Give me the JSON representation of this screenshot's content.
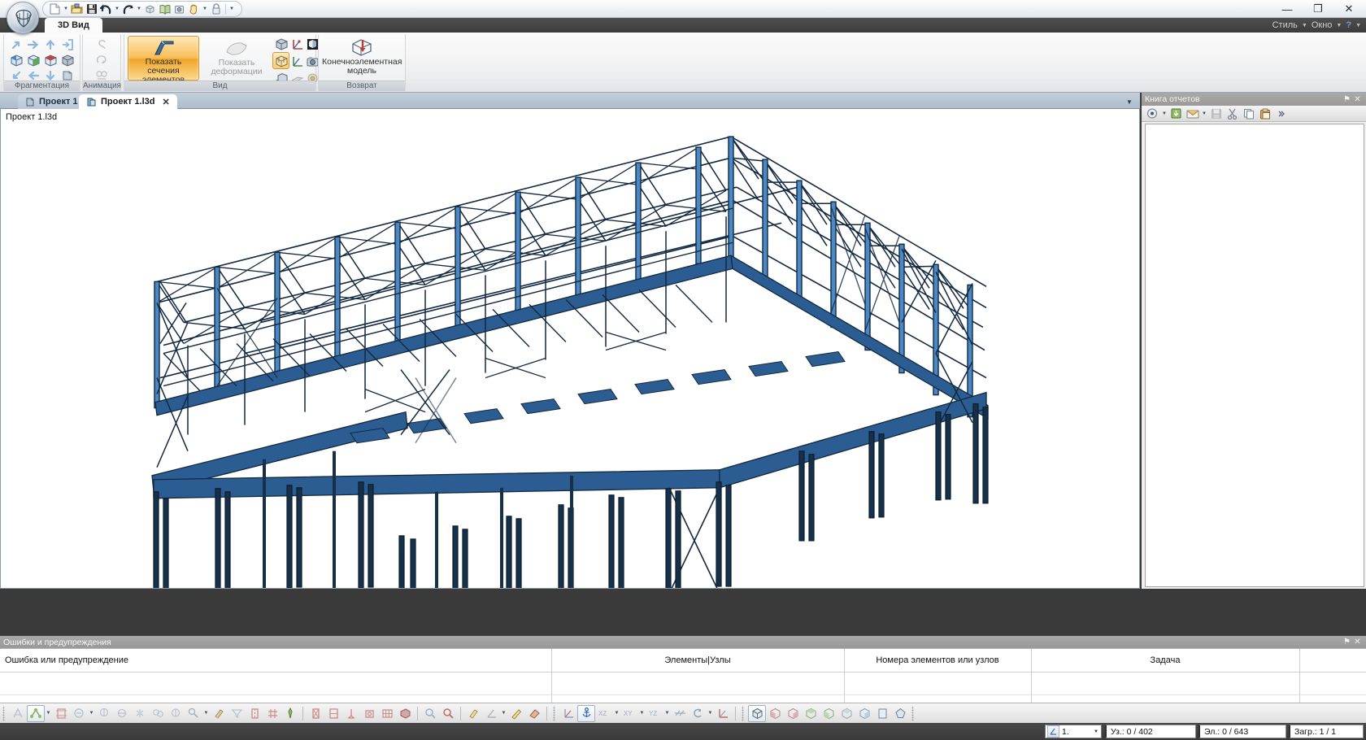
{
  "window": {
    "minimize_label": "—",
    "restore_label": "❐",
    "close_label": "✕"
  },
  "quick_access": {
    "items": [
      {
        "name": "new-document-icon",
        "glyph": "new"
      },
      {
        "name": "open-folder-icon",
        "glyph": "open"
      },
      {
        "name": "save-icon",
        "glyph": "save"
      },
      {
        "name": "undo-icon",
        "glyph": "undo"
      },
      {
        "name": "redo-icon",
        "glyph": "redo"
      },
      {
        "name": "model-icon",
        "glyph": "cube"
      },
      {
        "name": "book-icon",
        "glyph": "book"
      },
      {
        "name": "package-icon",
        "glyph": "package"
      },
      {
        "name": "hand-icon",
        "glyph": "hand"
      },
      {
        "name": "lock-icon",
        "glyph": "lock"
      },
      {
        "name": "customize-qat-icon",
        "glyph": "dropdown"
      }
    ]
  },
  "ribbon": {
    "tab": "3D Вид",
    "right_menu": {
      "style": "Стиль",
      "window": "Окно",
      "help": "?"
    },
    "groups": [
      {
        "id": "fragmentation",
        "label": "Фрагментация",
        "icons": [
          "arrow-up-right-icon",
          "arrow-right-icon",
          "arrow-up-icon",
          "arrow-into-box-icon",
          "cube-blue-icon",
          "cube-green-icon",
          "cube-red-icon",
          "cube-gray-icon",
          "arrow-down-left-icon",
          "arrow-left-icon",
          "arrow-down-icon",
          "box-restore-icon"
        ]
      },
      {
        "id": "animation",
        "label": "Анимация",
        "icons": [
          "loop-icon",
          "rotate-icon",
          "film-icon"
        ]
      },
      {
        "id": "view",
        "label": "Вид",
        "primary_button": "Показать сечения элементов",
        "primary_button_state": "active",
        "secondary_button": "Показать деформации",
        "secondary_button_state": "disabled",
        "icons": [
          "cube-solid-icon",
          "axes-red-icon",
          "cube-shaded-icon",
          "mesh-icon",
          "cube-grid-icon",
          "axes-green-icon",
          "camera-icon",
          "cube-origin-icon",
          "plane-icon",
          "sphere-icon"
        ]
      },
      {
        "id": "return",
        "label": "Возврат",
        "primary_button": "Конечноэлементная модель",
        "icons": [
          "fem-model-icon"
        ]
      }
    ]
  },
  "document_tabs": {
    "items": [
      {
        "label": "Проект 1",
        "active": false,
        "closable": false
      },
      {
        "label": "Проект 1.l3d",
        "active": true,
        "closable": true
      }
    ],
    "close_label": "✕",
    "overflow_label": "▼"
  },
  "viewport": {
    "label": "Проект 1.l3d",
    "background": "#ffffff",
    "model": {
      "name": "steel-frame-truss-structure",
      "edge_color": "#10263f",
      "column_color": "#4a88c8",
      "beam_color": "#2f6096",
      "fill_color": "#2b5d93"
    }
  },
  "report_panel": {
    "title": "Книга отчетов",
    "pin_label": "⚑",
    "close_label": "✕",
    "tools": [
      {
        "name": "report-new-icon"
      },
      {
        "name": "report-open-icon"
      },
      {
        "name": "report-mail-icon"
      },
      {
        "name": "report-save-icon"
      },
      {
        "name": "report-cut-icon"
      },
      {
        "name": "report-copy-icon"
      },
      {
        "name": "report-paste-icon"
      },
      {
        "name": "report-more-icon"
      }
    ]
  },
  "errors_panel": {
    "title": "Ошибки и предупреждения",
    "pin_label": "⚑",
    "close_label": "✕",
    "columns": [
      {
        "label": "Ошибка или предупреждение",
        "align": "left"
      },
      {
        "label": "Элементы|Узлы",
        "align": "center"
      },
      {
        "label": "Номера элементов или узлов",
        "align": "center"
      },
      {
        "label": "Задача",
        "align": "center"
      }
    ],
    "rows": []
  },
  "bottom_toolbar": {
    "groups": [
      {
        "name": "selection-tools",
        "items": [
          {
            "name": "select-all-icon",
            "selected": false
          },
          {
            "name": "select-nodes-icon",
            "selected": true,
            "dropdown": true
          },
          {
            "name": "select-frame-icon",
            "selected": false
          },
          {
            "name": "deselect-node-icon",
            "selected": false,
            "dropdown": true
          },
          {
            "name": "select-vertical-icon",
            "selected": false
          },
          {
            "name": "deselect-horizontal-icon",
            "selected": false
          },
          {
            "name": "select-star-icon",
            "selected": false
          },
          {
            "name": "select-group-icon",
            "selected": false
          },
          {
            "name": "select-single-icon",
            "selected": false
          },
          {
            "name": "pick-tool-icon",
            "selected": false,
            "dropdown": true
          },
          {
            "name": "paint-tool-icon",
            "selected": false
          },
          {
            "name": "filter-icon",
            "selected": false
          },
          {
            "name": "split-element-icon",
            "selected": false
          },
          {
            "name": "merge-element-icon",
            "selected": false
          },
          {
            "name": "measure-icon",
            "selected": false
          }
        ]
      },
      {
        "name": "element-tools",
        "items": [
          {
            "name": "node-red-icon",
            "selected": false
          },
          {
            "name": "beam-red-icon",
            "selected": false
          },
          {
            "name": "support-red-icon",
            "selected": false
          },
          {
            "name": "hinge-red-icon",
            "selected": false
          },
          {
            "name": "grid-red-icon",
            "selected": false
          },
          {
            "name": "plate-red-icon",
            "selected": false
          }
        ]
      },
      {
        "name": "zoom-tools",
        "items": [
          {
            "name": "zoom-in-icon",
            "selected": false
          },
          {
            "name": "zoom-select-icon",
            "selected": false
          }
        ]
      },
      {
        "name": "display-tools",
        "items": [
          {
            "name": "highlight-icon",
            "selected": false
          },
          {
            "name": "angle-icon",
            "selected": false,
            "dropdown": true
          },
          {
            "name": "pencil-icon",
            "selected": false
          },
          {
            "name": "eraser-icon",
            "selected": false
          }
        ]
      },
      {
        "name": "axis-tools",
        "items": [
          {
            "name": "axes-local-icon",
            "selected": false
          },
          {
            "name": "anchor-icon",
            "selected": true
          },
          {
            "name": "plane-xz-icon",
            "selected": false,
            "label": "XZ",
            "dropdown": true
          },
          {
            "name": "plane-xy-icon",
            "selected": false,
            "label": "XY",
            "dropdown": true
          },
          {
            "name": "plane-yz-icon",
            "selected": false,
            "label": "YZ",
            "dropdown": true
          },
          {
            "name": "parallel-icon",
            "selected": false
          },
          {
            "name": "rotate-view-icon",
            "selected": false,
            "dropdown": true
          },
          {
            "name": "axes-global-icon",
            "selected": false
          }
        ]
      },
      {
        "name": "view-preset-tools",
        "items": [
          {
            "name": "view-iso-icon",
            "selected": true
          },
          {
            "name": "view-front-icon",
            "selected": false
          },
          {
            "name": "view-back-icon",
            "selected": false
          },
          {
            "name": "view-left-icon",
            "selected": false
          },
          {
            "name": "view-right-icon",
            "selected": false
          },
          {
            "name": "view-top-icon",
            "selected": false
          },
          {
            "name": "view-bottom-icon",
            "selected": false
          },
          {
            "name": "view-plan-icon",
            "selected": false
          },
          {
            "name": "view-perspective-icon",
            "selected": false
          }
        ]
      }
    ]
  },
  "status_bar": {
    "layer_selector": "1.",
    "layer_dropdown_label": "▼",
    "nodes": "Уз.: 0 / 402",
    "elements": "Эл.: 0 / 643",
    "loads": "Загр.: 1 / 1"
  },
  "colors": {
    "ribbon_accent": "#f0a427",
    "panel_header": "#9a9a9a",
    "status_bg": "#3f3f3f",
    "tab_active": "#ffffff",
    "model_blue": "#2b5d93"
  }
}
